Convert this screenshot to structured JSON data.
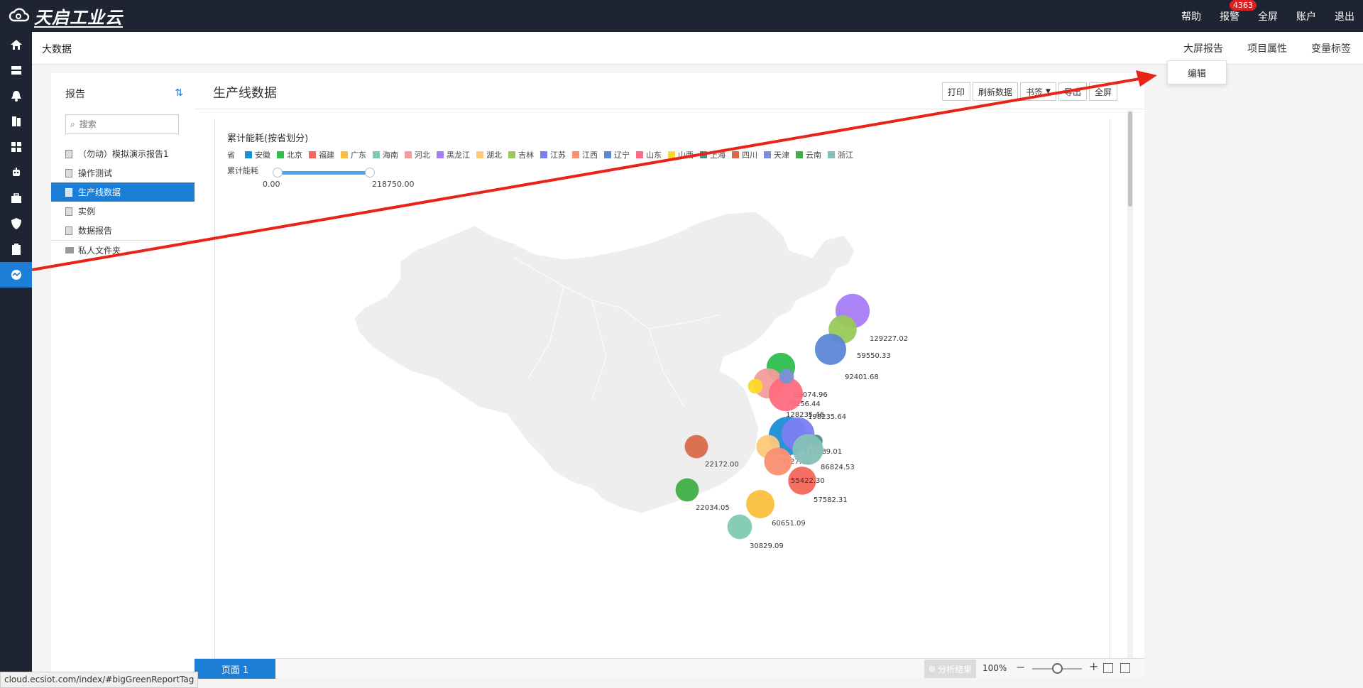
{
  "app": {
    "logo_text": "天启工业云"
  },
  "topnav": {
    "links": [
      "帮助",
      "报警",
      "全屏",
      "账户",
      "退出"
    ],
    "alarm_badge": "4363"
  },
  "leftnav": {
    "icons": [
      "home-icon",
      "server-icon",
      "bell-icon",
      "book-icon",
      "dashboard-icon",
      "robot-icon",
      "briefcase-icon",
      "shield-icon",
      "clipboard-icon",
      "chart-icon"
    ],
    "active_index": 9
  },
  "breadcrumb": {
    "title": "大数据",
    "tabs": [
      "大屏报告",
      "项目属性",
      "变量标签"
    ]
  },
  "dropdown": {
    "item": "编辑"
  },
  "sidepanel": {
    "title": "报告",
    "search_placeholder": "搜索",
    "items": [
      "（勿动）模拟演示报告1",
      "操作测试",
      "生产线数据",
      "实例",
      "数据报告"
    ],
    "active_index": 2,
    "folder": "私人文件夹"
  },
  "report": {
    "title": "生产线数据",
    "toolbar": [
      "打印",
      "刷新数据",
      "书签",
      "导出",
      "全屏"
    ]
  },
  "chart_data": {
    "type": "scatter",
    "title": "累计能耗(按省划分)",
    "legend_label": "省",
    "visual_map_label": "累计能耗",
    "visual_map_range": [
      "0.00",
      "218750.00"
    ],
    "series": [
      {
        "name": "安徽",
        "color": "#1c8ed6",
        "value": 198235.64
      },
      {
        "name": "北京",
        "color": "#2ebd4e",
        "value": 63074.96
      },
      {
        "name": "福建",
        "color": "#f2675a",
        "value": 57582.31
      },
      {
        "name": "广东",
        "color": "#fbc03b",
        "value": 60651.09
      },
      {
        "name": "海南",
        "color": "#7ecab0",
        "value": 30829.09
      },
      {
        "name": "河北",
        "color": "#f39c9c",
        "value": 79256.44
      },
      {
        "name": "黑龙江",
        "color": "#a57cf5",
        "value": 129227.02
      },
      {
        "name": "湖北",
        "color": "#fdc97a",
        "value": 23327.1
      },
      {
        "name": "吉林",
        "color": "#99c95a",
        "value": 59550.33
      },
      {
        "name": "江苏",
        "color": "#7b7ef0",
        "value": 113289.01
      },
      {
        "name": "江西",
        "color": "#fb8f70",
        "value": 55422.3
      },
      {
        "name": "辽宁",
        "color": "#5c88d6",
        "value": 92401.68
      },
      {
        "name": "山东",
        "color": "#ff6b80",
        "value": 128235.46
      },
      {
        "name": "山西",
        "color": "#fdd92a",
        "value": null
      },
      {
        "name": "上海",
        "color": "#4a8d85",
        "value": null
      },
      {
        "name": "四川",
        "color": "#d9694a",
        "value": 22172.0
      },
      {
        "name": "天津",
        "color": "#7d8fd4",
        "value": null
      },
      {
        "name": "云南",
        "color": "#3fae45",
        "value": 22034.05
      },
      {
        "name": "浙江",
        "color": "#85c0b8",
        "value": 86824.53
      }
    ]
  },
  "bottom": {
    "page_tab": "页面 1",
    "analysis": "分析结果",
    "zoom": "100%"
  },
  "status_bar": {
    "url": "cloud.ecsiot.com/index/#bigGreenReportTag"
  },
  "colors": {
    "accent": "#1c7ed6",
    "topbar": "#1e2431",
    "arrow": "#e82418"
  }
}
